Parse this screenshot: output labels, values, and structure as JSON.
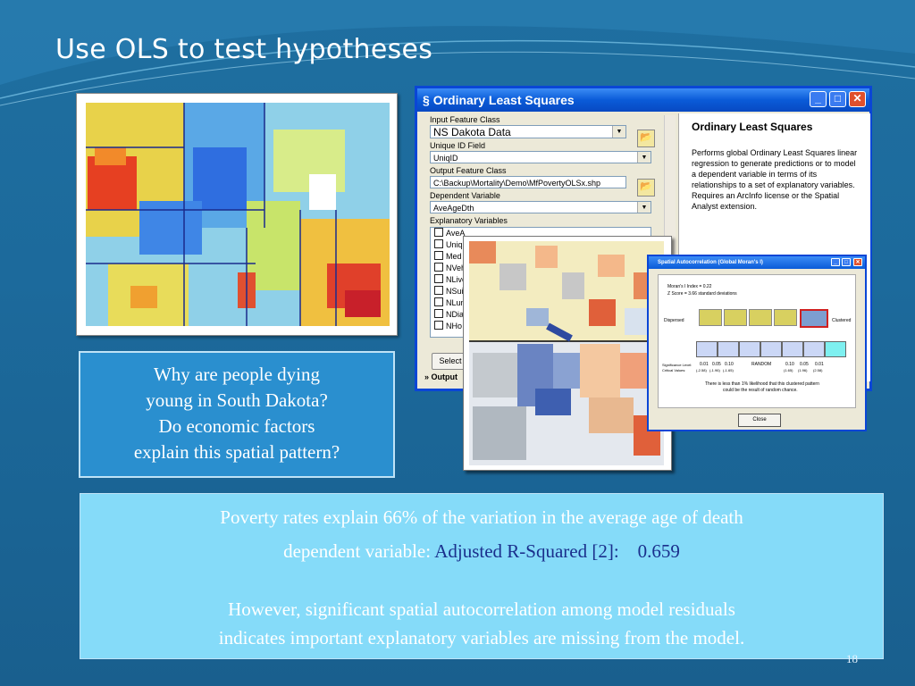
{
  "slide": {
    "title": "Use OLS to test hypotheses",
    "page_number": "18"
  },
  "question_box": {
    "lines": [
      "Why are people dying",
      "young in South Dakota?",
      "Do economic factors",
      "explain this spatial pattern?"
    ]
  },
  "ols_window": {
    "title": "Ordinary Least Squares",
    "input_feature_class_label": "Input Feature Class",
    "input_feature_class_value": "NS Dakota Data",
    "unique_id_label": "Unique ID Field",
    "unique_id_value": "UniqID",
    "output_feature_class_label": "Output Feature Class",
    "output_feature_class_value": "C:\\Backup\\Mortality\\Demo\\MfPovertyOLSx.shp",
    "dependent_variable_label": "Dependent Variable",
    "dependent_variable_value": "AveAgeDth",
    "explanatory_variables_label": "Explanatory Variables",
    "explanatory_variables": [
      "AveA",
      "Uniq",
      "Med",
      "NVeh",
      "NLive",
      "NSui",
      "NLun",
      "NDia",
      "NHo"
    ],
    "select_button": "Select",
    "output_label": "Output",
    "help_title": "Ordinary Least Squares",
    "help_text": "Performs global Ordinary Least Squares linear regression to generate predictions or to model a dependent variable in terms of its relationships to a set of explanatory variables. Requires an ArcInfo license or the Spatial Analyst extension."
  },
  "spatial_autocorrelation": {
    "title": "Spatial Autocorrelation (Global Moran's I)",
    "morans_index": "Moran's I Index = 0.22",
    "z_score": "Z Score = 3.66 standard deviations",
    "dispersed_label": "Dispersed",
    "clustered_label": "Clustered",
    "significance_label": "Significance Level:",
    "critical_values_label": "Critical Values:",
    "significance_values": [
      "0.01",
      "0.05",
      "0.10",
      "RANDOM",
      "0.10",
      "0.05",
      "0.01"
    ],
    "critical_values": [
      "(-2.58)",
      "(-1.96)",
      "(-1.65)",
      "",
      "(1.65)",
      "(1.96)",
      "(2.58)"
    ],
    "conclusion_line1": "There is less than 1% likelihood that this clustered pattern",
    "conclusion_line2": "could be the result of random chance.",
    "close_button": "Close"
  },
  "findings": {
    "line1": "Poverty rates explain 66% of the variation in the average age of death",
    "line2_prefix": "dependent variable:",
    "line2_highlight": "Adjusted R-Squared [2]:    0.659",
    "line3": "However, significant spatial autocorrelation among model residuals",
    "line4": "indicates important explanatory variables are missing from the model."
  }
}
